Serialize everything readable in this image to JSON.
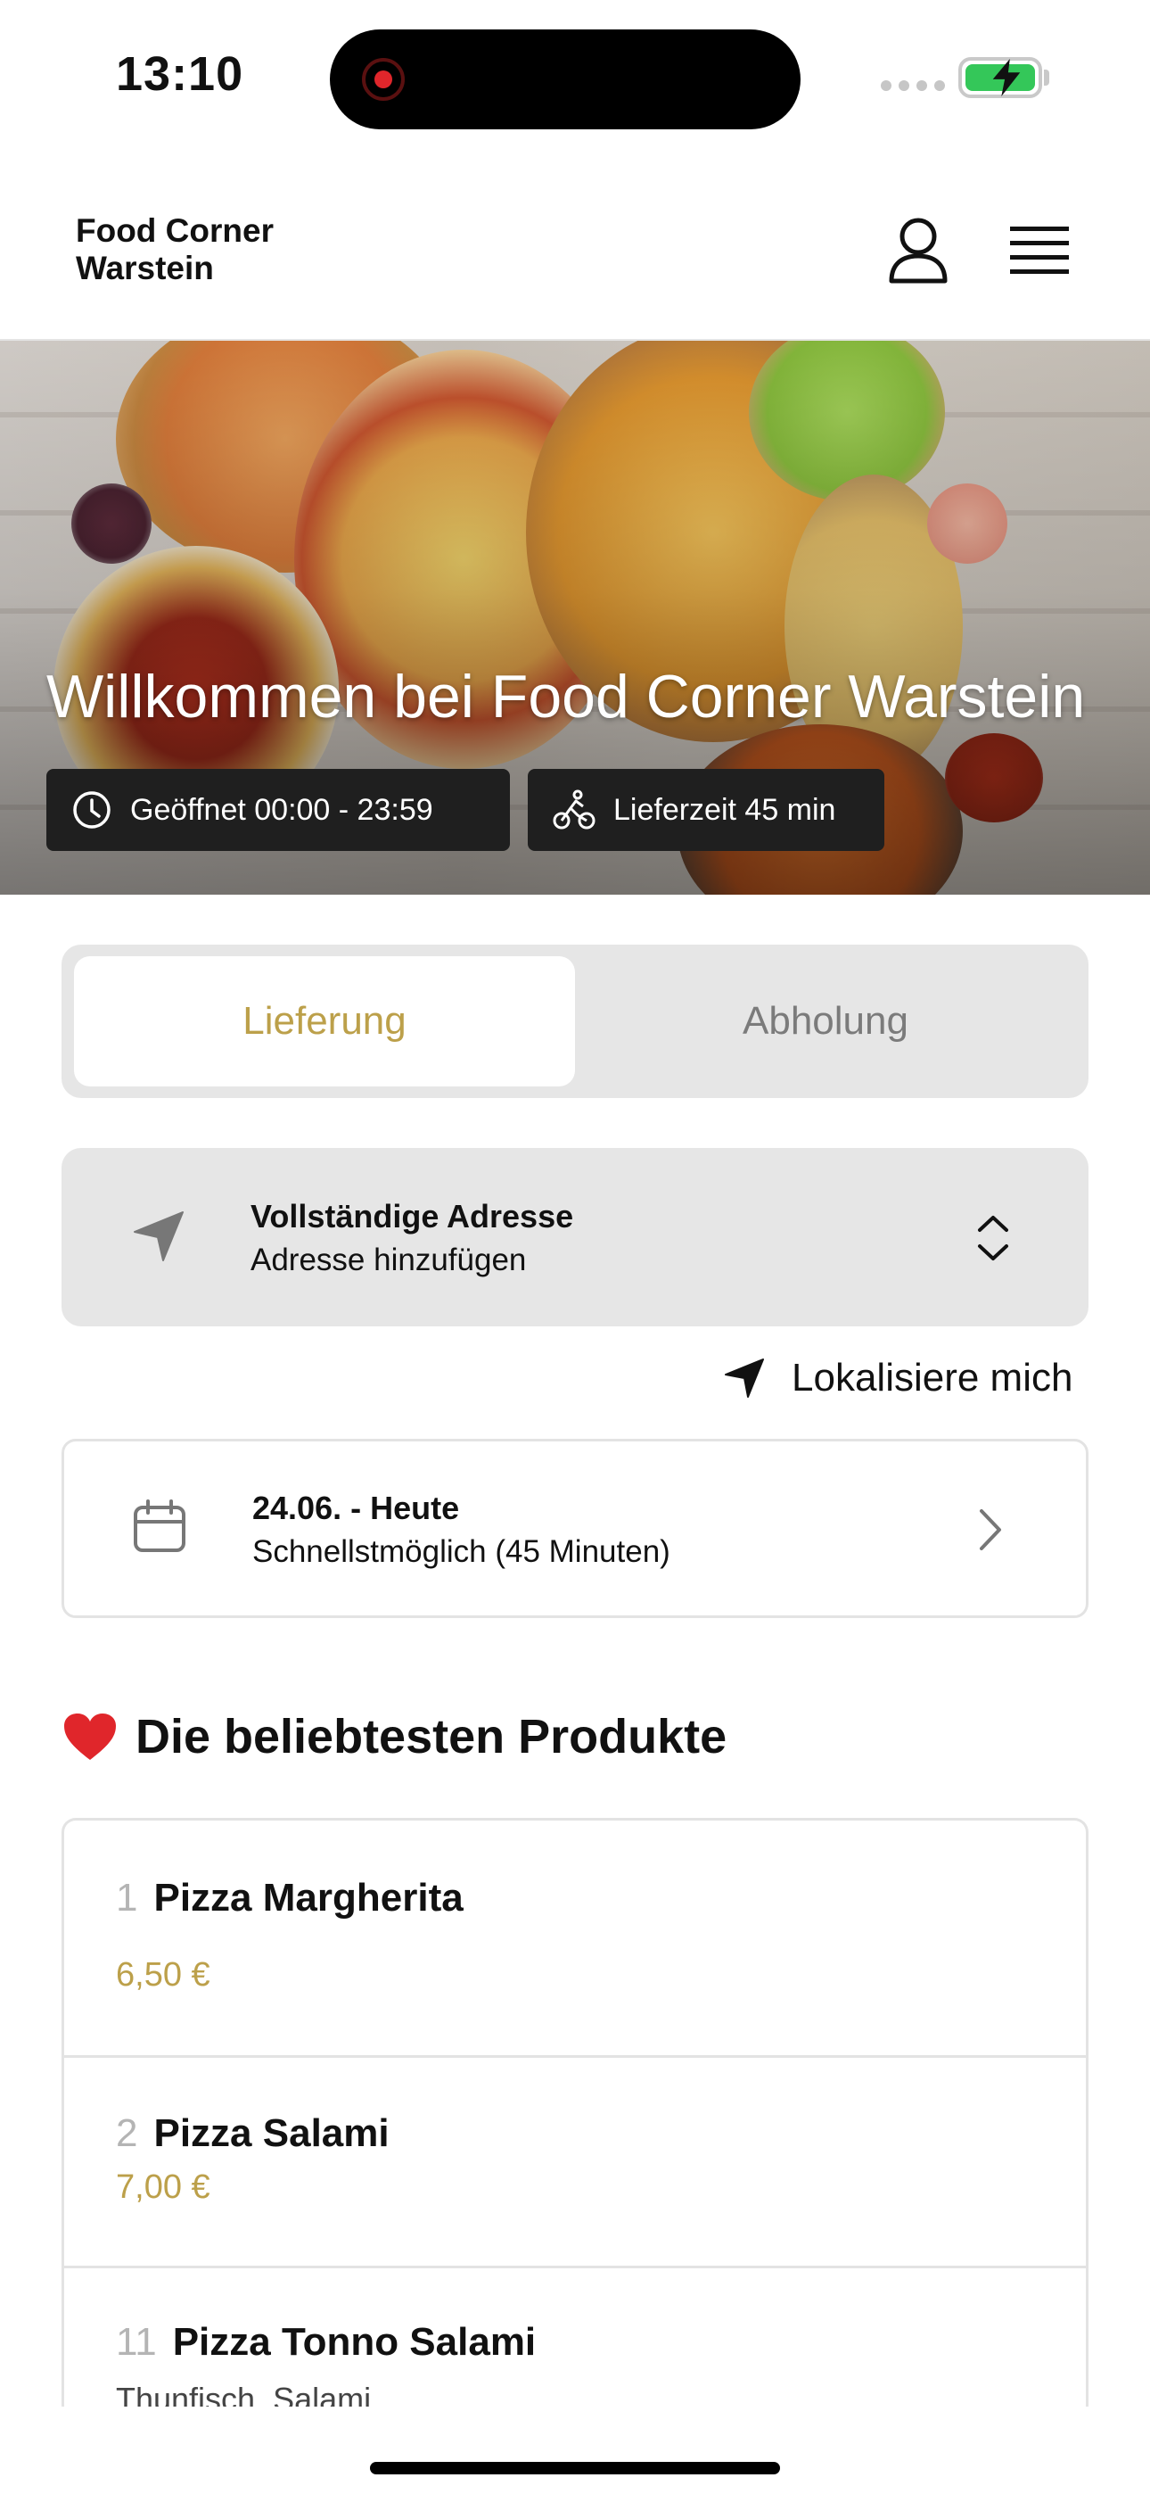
{
  "status_bar": {
    "time": "13:10"
  },
  "header": {
    "brand": "Food Corner\nWarstein",
    "icons": [
      "user-icon",
      "menu-icon"
    ]
  },
  "hero": {
    "title": "Willkommen bei Food Corner Warstein",
    "opening_chip": "Geöffnet 00:00 - 23:59",
    "delivery_chip": "Lieferzeit 45 min"
  },
  "order_mode": {
    "delivery": "Lieferung",
    "pickup": "Abholung",
    "selected": "Lieferung"
  },
  "address": {
    "title": "Vollständige Adresse",
    "subtitle": "Adresse hinzufügen"
  },
  "locate": {
    "label": "Lokalisiere mich"
  },
  "schedule": {
    "title": "24.06. - Heute",
    "subtitle": "Schnellstmöglich (45 Minuten)"
  },
  "popular": {
    "heading": "Die beliebtesten Produkte",
    "items": [
      {
        "num": "1",
        "name": "Pizza Margherita",
        "price": "6,50 €"
      },
      {
        "num": "2",
        "name": "Pizza Salami",
        "price": "7,00 €"
      },
      {
        "num": "11",
        "name": "Pizza Tonno Salami",
        "desc": "Thunfisch, Salami"
      }
    ]
  },
  "colors": {
    "accent": "#bca04a",
    "chip_bg": "#1f1f1f",
    "card_bg": "#e6e6e6"
  }
}
